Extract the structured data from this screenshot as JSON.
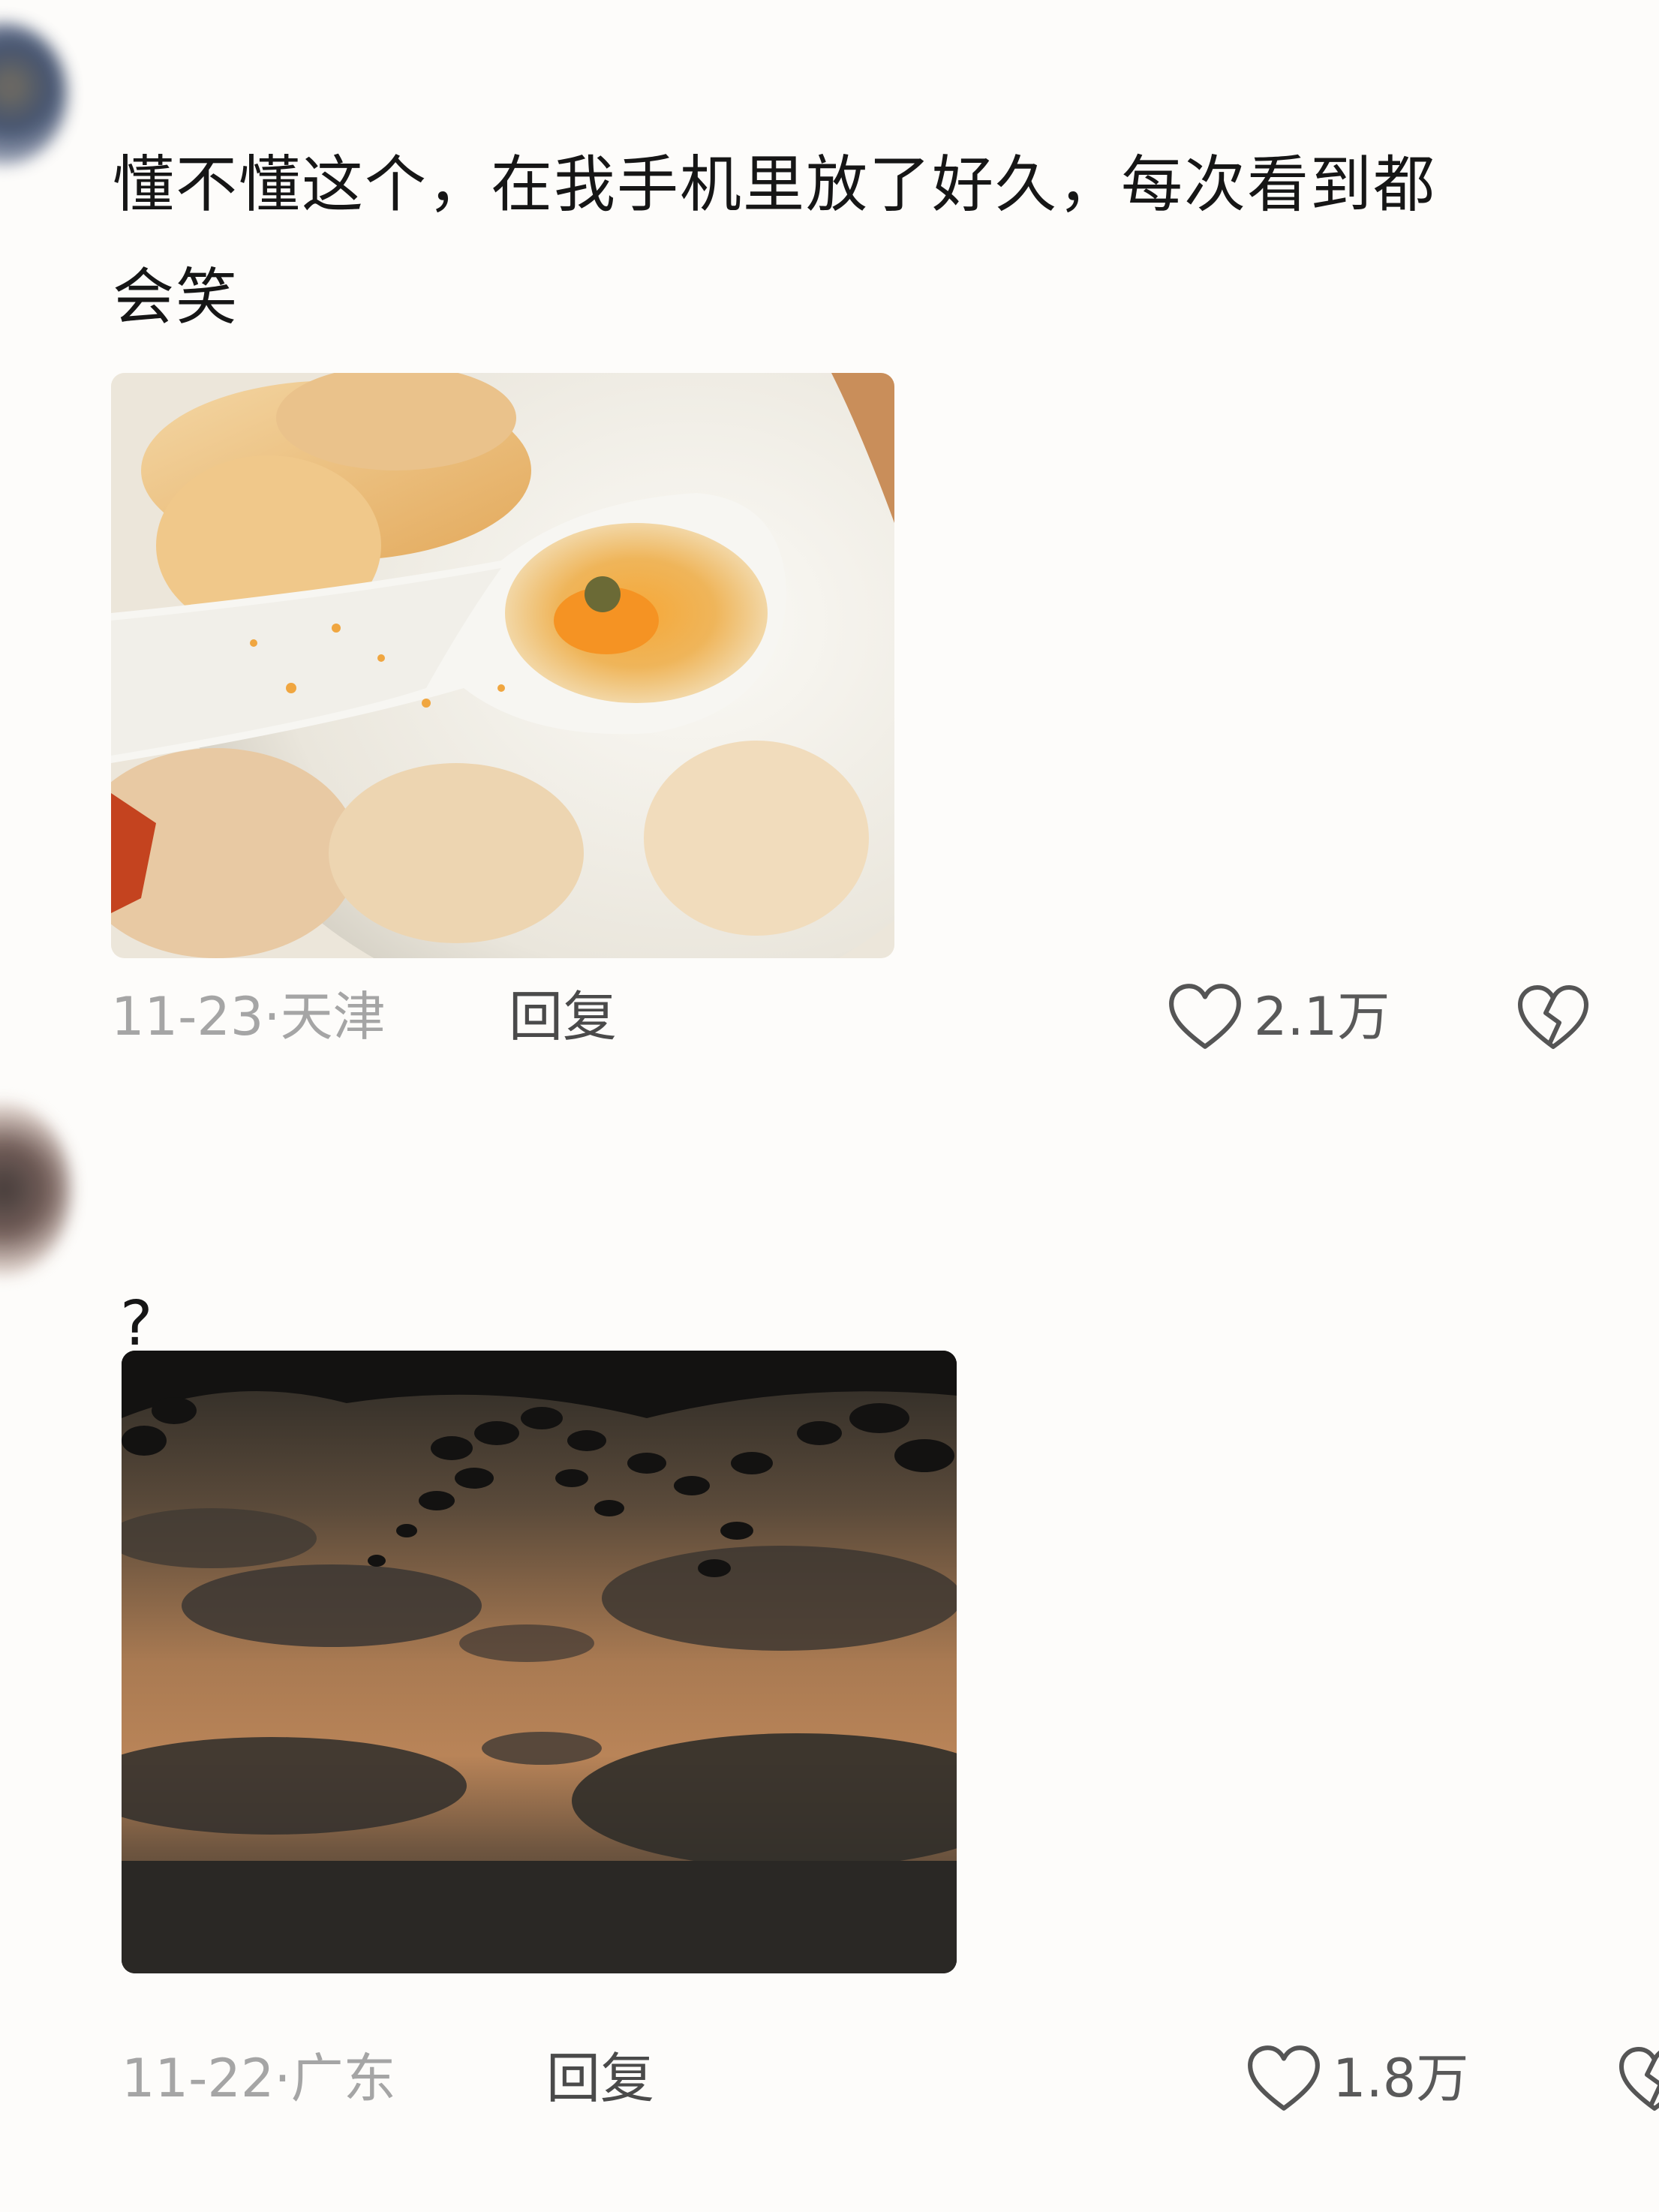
{
  "comments": [
    {
      "text": "懂不懂这个，在我手机里放了好久，每次看到都\n会笑",
      "date": "11-23",
      "separator": "·",
      "location": "天津",
      "reply_label": "回复",
      "likes": "2.1万",
      "image_icon": "photo-spoon-dumplings",
      "like_icon": "heart-outline-icon",
      "dislike_icon": "broken-heart-icon"
    },
    {
      "text": "?",
      "date": "11-22",
      "separator": "·",
      "location": "广东",
      "reply_label": "回复",
      "likes": "1.8万",
      "image_icon": "photo-sunset-sky",
      "like_icon": "heart-outline-icon",
      "dislike_icon": "broken-heart-icon"
    }
  ],
  "colors": {
    "background": "#fdfcfa",
    "text": "#161616",
    "meta_text": "#a5a5a5",
    "reply_text": "#4a4a4a",
    "icon_stroke": "#555555"
  }
}
